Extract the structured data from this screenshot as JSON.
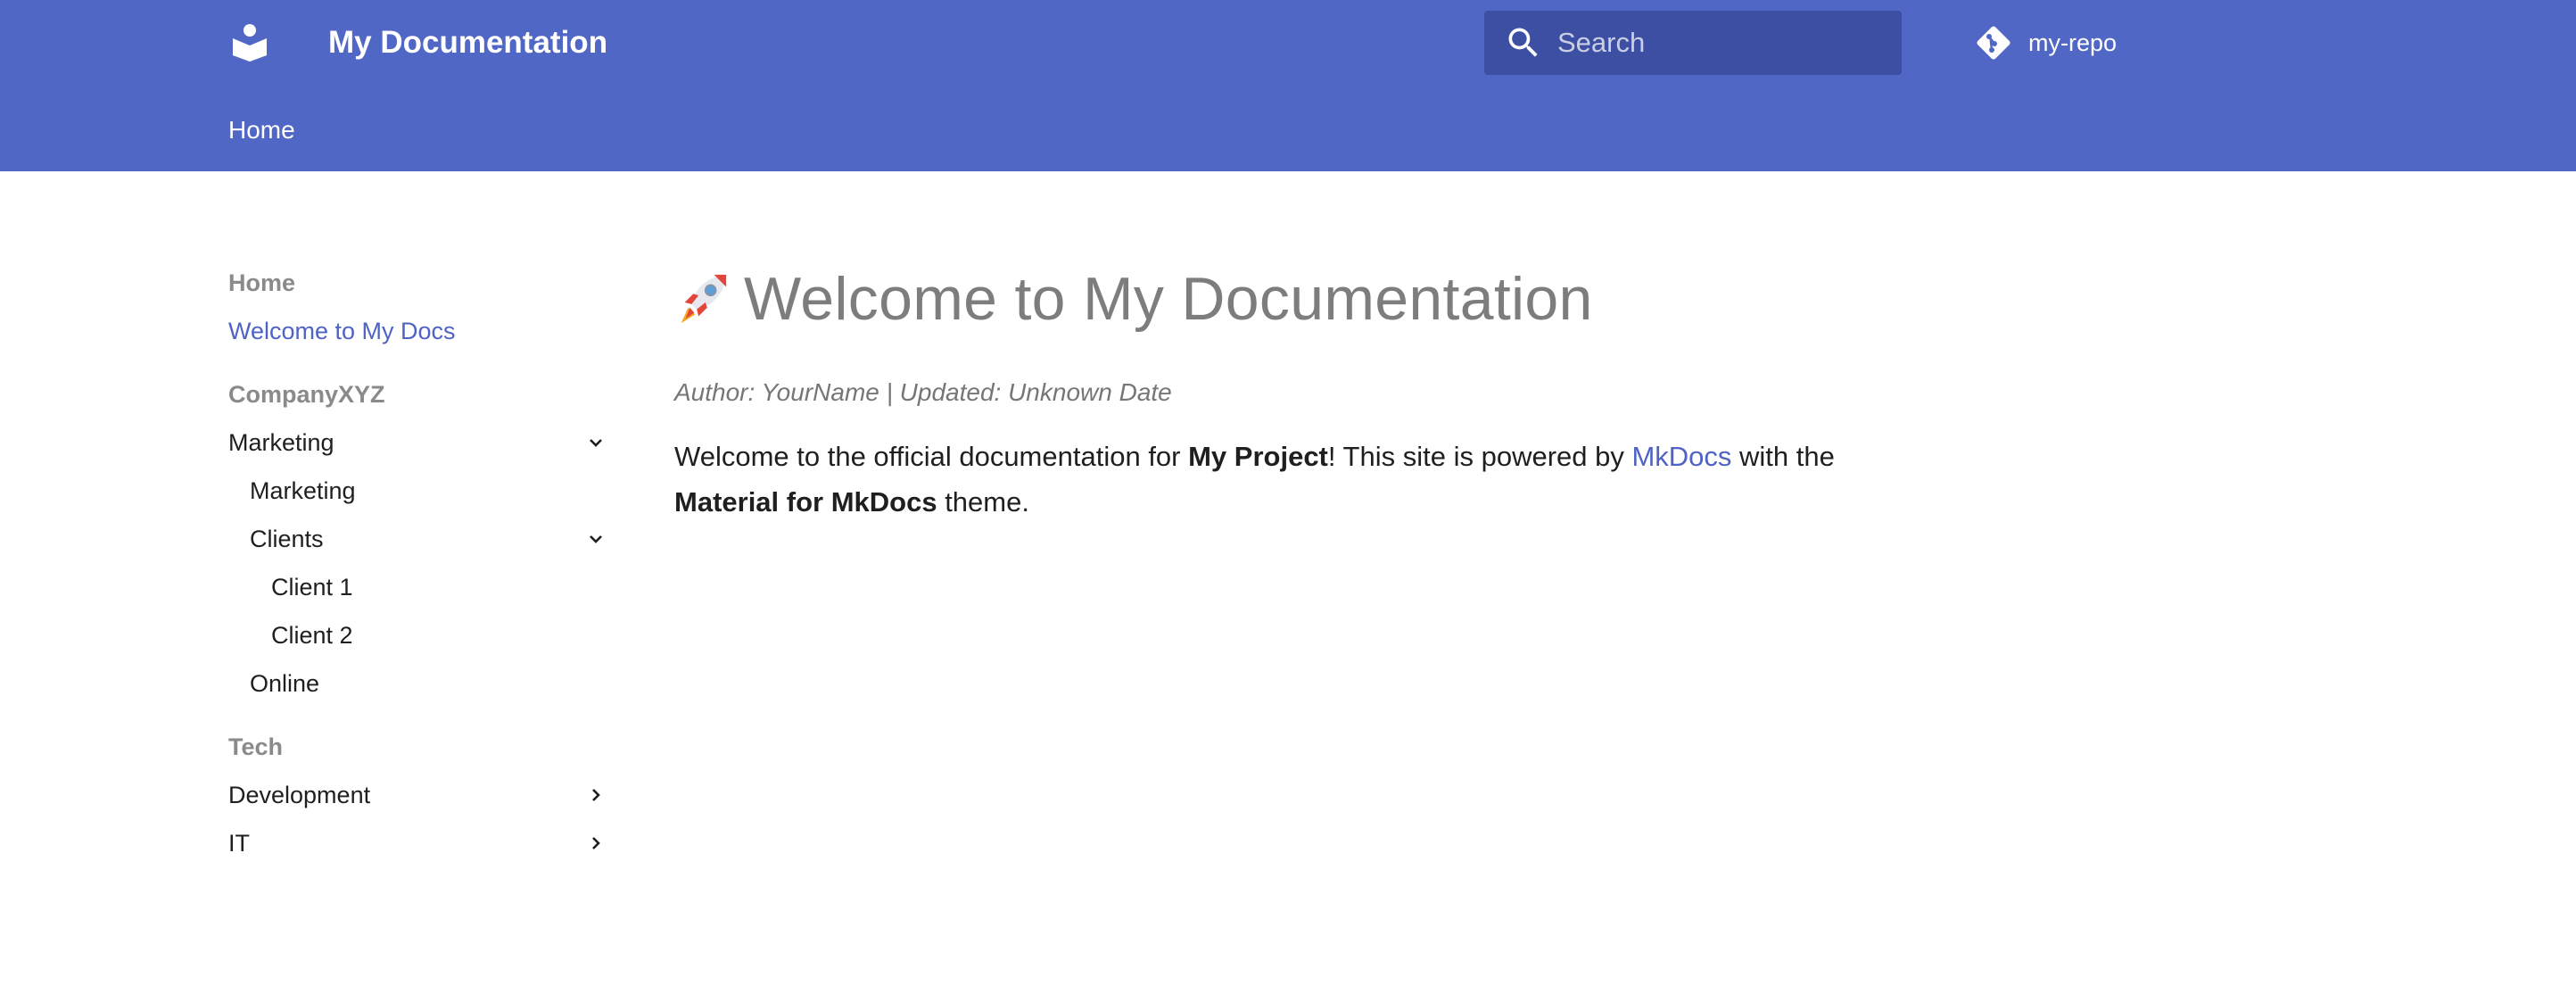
{
  "header": {
    "site_title": "My Documentation",
    "logo_icon": "book-reader-icon",
    "search_placeholder": "Search",
    "search_value": "",
    "repo_name": "my-repo",
    "repo_icon": "git-icon",
    "color": "#5067c5"
  },
  "tabs": [
    {
      "label": "Home"
    }
  ],
  "sidebar": {
    "home_section": "Home",
    "welcome": "Welcome to My Docs",
    "company_section": "CompanyXYZ",
    "marketing": "Marketing",
    "marketing_page": "Marketing",
    "clients": "Clients",
    "client1": "Client 1",
    "client2": "Client 2",
    "online": "Online",
    "tech_section": "Tech",
    "development": "Development",
    "it": "IT",
    "active_color": "#4e63c4"
  },
  "content": {
    "title_icon": "rocket-icon",
    "title": "Welcome to My Documentation",
    "meta": "Author: YourName | Updated: Unknown Date",
    "para_1": "Welcome to the official documentation for ",
    "para_bold_1": "My Project",
    "para_2": "! This site is powered by ",
    "para_link": "MkDocs",
    "para_3": " with the ",
    "para_bold_2": "Material for MkDocs",
    "para_4": " theme."
  }
}
